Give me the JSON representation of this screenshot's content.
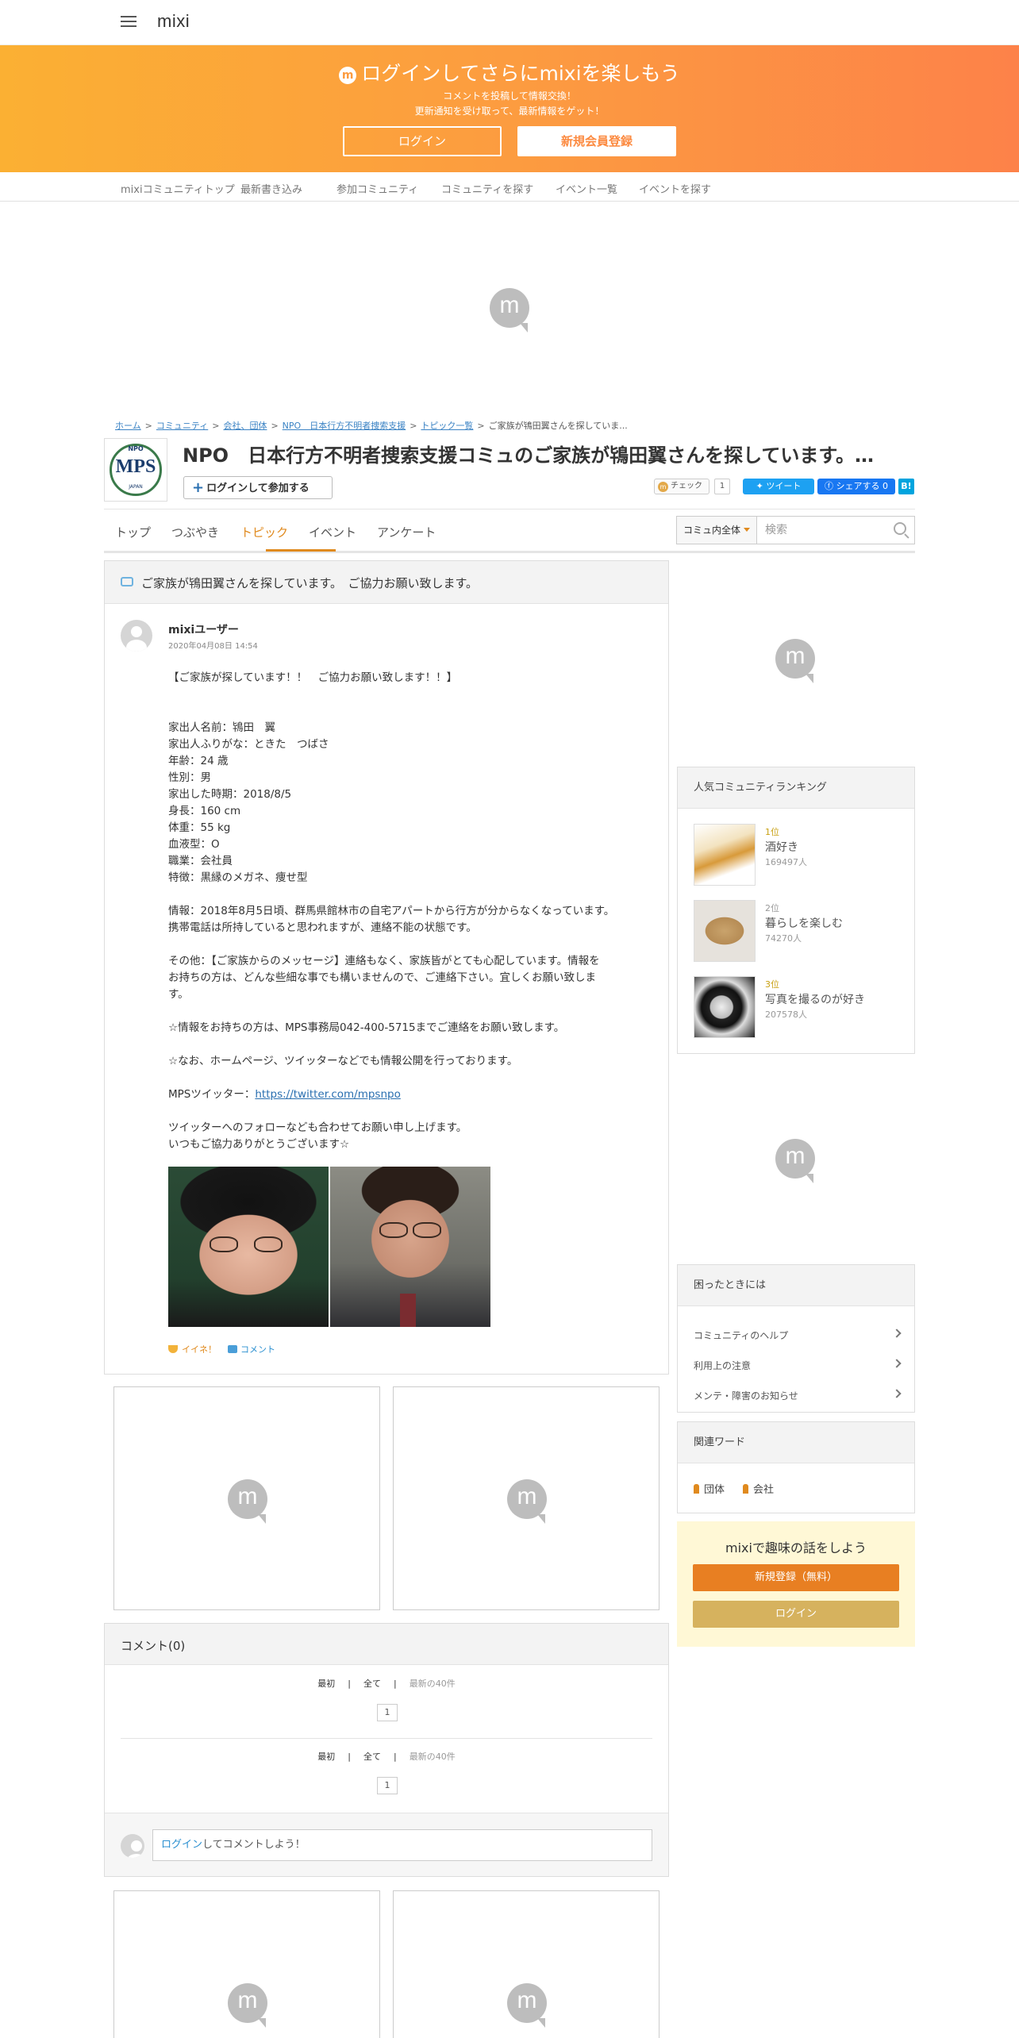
{
  "header": {
    "logo": "mixi"
  },
  "banner": {
    "title": "ログインしてさらにmixiを楽しもう",
    "sub1": "コメントを投稿して情報交換！",
    "sub2": "更新通知を受け取って、最新情報をゲット！",
    "login": "ログイン",
    "register": "新規会員登録"
  },
  "subnav": [
    "mixiコミュニティトップ",
    "最新書き込み",
    "参加コミュニティ",
    "コミュニティを探す",
    "イベント一覧",
    "イベントを探す"
  ],
  "ad_mark": "m",
  "breadcrumb": [
    "ホーム",
    "コミュニティ",
    "会社、団体",
    "NPO　日本行方不明者捜索支援",
    "トピック一覧",
    "ご家族が鴇田翼さんを探していま..."
  ],
  "community": {
    "logo_text": "MPS",
    "logo_top": "NPO",
    "logo_bottom": "JAPAN",
    "title": "NPO　日本行方不明者捜索支援コミュのご家族が鴇田翼さんを探しています。…",
    "join": "ログインして参加する",
    "check": "チェック",
    "check_count": "1",
    "tweet": "ツイート",
    "share": "シェアする 0",
    "hatena": "B!"
  },
  "tabs": [
    "トップ",
    "つぶやき",
    "トピック",
    "イベント",
    "アンケート"
  ],
  "search": {
    "scope": "コミュ内全体",
    "placeholder": "検索"
  },
  "topic": {
    "title": "ご家族が鴇田翼さんを探しています。　ご協力お願い致します。",
    "author": "mixiユーザー",
    "date": "2020年04月08日 14:54",
    "lines": [
      "【ご家族が探しています！！　ご協力お願い致します！！】",
      "家出人名前：鴇田　翼",
      "家出人ふりがな：ときた　つばさ",
      "年齢：24 歳",
      "性別：男",
      "家出した時期：2018/8/5",
      "身長：160 cm",
      "体重：55 kg",
      "血液型：O",
      "職業：会社員",
      "特徴：黒縁のメガネ、痩せ型",
      "情報：2018年8月5日頃、群馬県館林市の自宅アパートから行方が分からなくなっています。",
      "携帯電話は所持していると思われますが、連絡不能の状態です。",
      "その他：【ご家族からのメッセージ】連絡もなく、家族皆がとても心配しています。情報を",
      "お持ちの方は、どんな些細な事でも構いませんので、ご連絡下さい。宜しくお願い致しま",
      "す。",
      "☆情報をお持ちの方は、MPS事務局042-400-5715までご連絡をお願い致します。",
      "☆なお、ホームページ、ツイッターなどでも情報公開を行っております。",
      "MPSツイッター：",
      "ツイッターへのフォローなども合わせてお願い申し上げます。",
      "いつもご協力ありがとうございます☆"
    ],
    "twitter_url": "https://twitter.com/mpsnpo",
    "like": "イイネ！",
    "comment": "コメント"
  },
  "comments": {
    "title": "コメント(0)",
    "first": "最初",
    "all": "全て",
    "latest": "最新の40件",
    "page": "1",
    "login_link": "ログイン",
    "prompt": "してコメントしよう！"
  },
  "ranking": {
    "title": "人気コミュニティランキング",
    "items": [
      {
        "rank": "1位",
        "name": "酒好き",
        "count": "169497人"
      },
      {
        "rank": "2位",
        "name": "暮らしを楽しむ",
        "count": "74270人"
      },
      {
        "rank": "3位",
        "name": "写真を撮るのが好き",
        "count": "207578人"
      }
    ]
  },
  "help": {
    "title": "困ったときには",
    "items": [
      "コミュニティのヘルプ",
      "利用上の注意",
      "メンテ・障害のお知らせ"
    ]
  },
  "related": {
    "title": "関連ワード",
    "words": [
      "団体",
      "会社"
    ]
  },
  "promo": {
    "title": "mixiで趣味の話をしよう",
    "register": "新規登録（無料）",
    "login": "ログイン"
  }
}
